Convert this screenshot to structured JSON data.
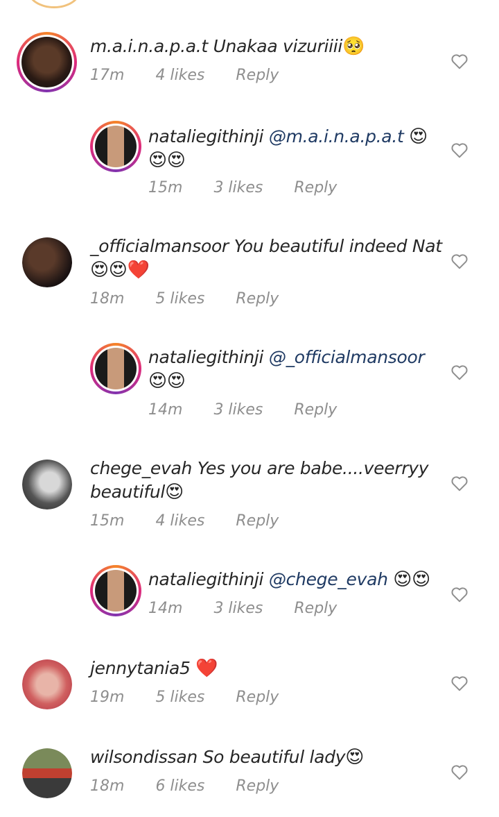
{
  "comments": [
    {
      "user": "m.a.i.n.a.p.a.t",
      "text": "Unakaa vizuriiii",
      "emoji": "🥺",
      "time": "17m",
      "likes": "4 likes",
      "reply": "Reply"
    },
    {
      "user": "nataliegithinji",
      "mention": "@m.a.i.n.a.p.a.t",
      "emoji": "😍",
      "emoji2": "😍😍",
      "time": "15m",
      "likes": "3 likes",
      "reply": "Reply"
    },
    {
      "user": "_officialmansoor",
      "text": "You beautiful indeed Nat",
      "emoji": "😍😍❤️",
      "time": "18m",
      "likes": "5 likes",
      "reply": "Reply"
    },
    {
      "user": "nataliegithinji",
      "mention": "@_officialmansoor",
      "emoji": "😍😍",
      "time": "14m",
      "likes": "3 likes",
      "reply": "Reply"
    },
    {
      "user": "chege_evah",
      "text": "Yes you are babe....veerryy",
      "text2": "beautiful",
      "emoji": "😍",
      "time": "15m",
      "likes": "4 likes",
      "reply": "Reply"
    },
    {
      "user": "nataliegithinji",
      "mention": "@chege_evah",
      "emoji": "😍😍",
      "time": "14m",
      "likes": "3 likes",
      "reply": "Reply"
    },
    {
      "user": "jennytania5",
      "emoji": "❤️",
      "time": "19m",
      "likes": "5 likes",
      "reply": "Reply"
    },
    {
      "user": "wilsondissan",
      "text": "So beautiful lady",
      "emoji": "😍",
      "time": "18m",
      "likes": "6 likes",
      "reply": "Reply"
    }
  ]
}
